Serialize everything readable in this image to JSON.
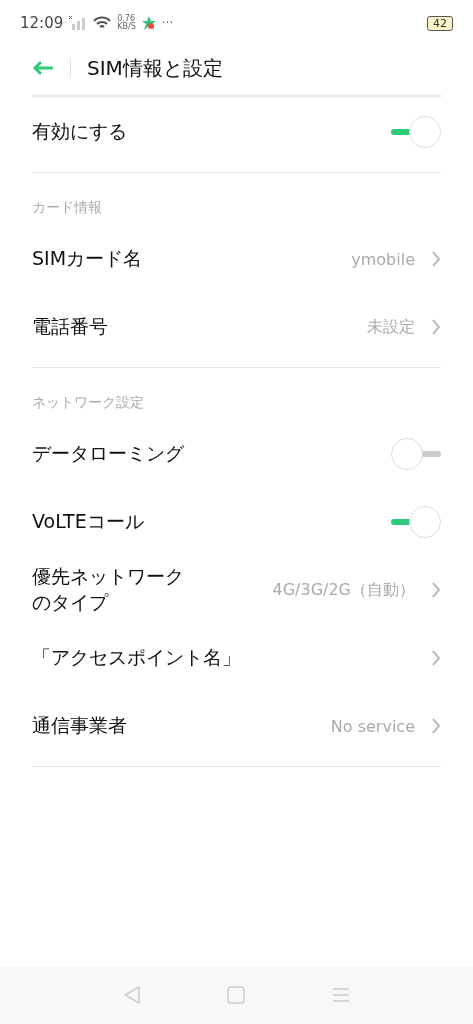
{
  "status_bar": {
    "time": "12:09",
    "speed_value": "0.76",
    "speed_unit": "KB/S",
    "more": "···",
    "battery": "42"
  },
  "header": {
    "title": "SIM情報と設定"
  },
  "groups": [
    {
      "rows": [
        {
          "kind": "toggle",
          "label": "有効にする",
          "on": true
        }
      ]
    },
    {
      "header": "カード情報",
      "rows": [
        {
          "kind": "link",
          "label": "SIMカード名",
          "value": "ymobile"
        },
        {
          "kind": "link",
          "label": "電話番号",
          "value": "未設定"
        }
      ]
    },
    {
      "header": "ネットワーク設定",
      "rows": [
        {
          "kind": "toggle",
          "label": "データローミング",
          "on": false
        },
        {
          "kind": "toggle",
          "label": "VoLTEコール",
          "on": true
        },
        {
          "kind": "link",
          "label": "優先ネットワークのタイプ",
          "value": "4G/3G/2G（自動）"
        },
        {
          "kind": "link",
          "label": "「アクセスポイント名」"
        },
        {
          "kind": "link",
          "label": "通信事業者",
          "value": "No service"
        }
      ]
    }
  ]
}
